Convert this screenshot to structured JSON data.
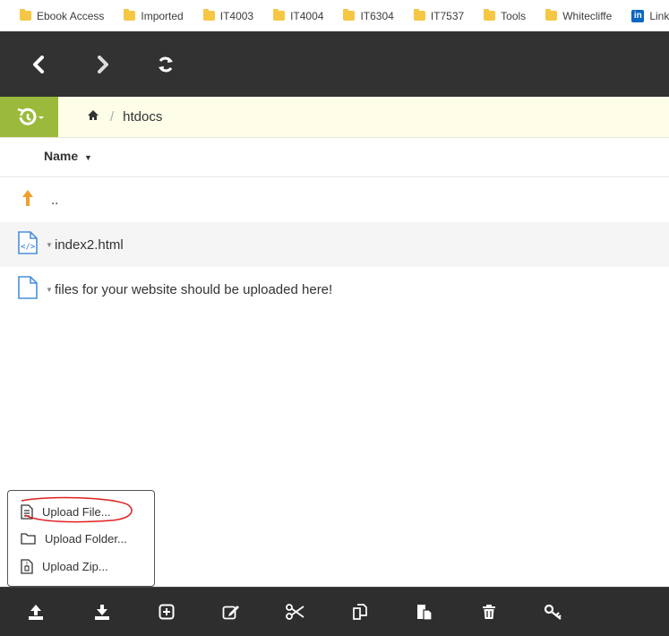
{
  "bookmarks": [
    {
      "label": "Ebook Access",
      "icon": "folder-icon"
    },
    {
      "label": "Imported",
      "icon": "folder-icon"
    },
    {
      "label": "IT4003",
      "icon": "folder-icon"
    },
    {
      "label": "IT4004",
      "icon": "folder-icon"
    },
    {
      "label": "IT6304",
      "icon": "folder-icon"
    },
    {
      "label": "IT7537",
      "icon": "folder-icon"
    },
    {
      "label": "Tools",
      "icon": "folder-icon"
    },
    {
      "label": "Whitecliffe",
      "icon": "folder-icon"
    },
    {
      "label": "LinkedIn Lea",
      "icon": "linkedin-icon"
    }
  ],
  "breadcrumb": {
    "home_icon": "home-icon",
    "separator": "/",
    "folder": "htdocs"
  },
  "columns": {
    "name": "Name"
  },
  "files": [
    {
      "name": "..",
      "icon": "parent-folder-icon"
    },
    {
      "name": "index2.html",
      "icon": "html-file-icon"
    },
    {
      "name": "files for your website should be uploaded here!",
      "icon": "file-icon"
    }
  ],
  "upload_menu": {
    "items": [
      {
        "label": "Upload File...",
        "icon": "file-text-icon"
      },
      {
        "label": "Upload Folder...",
        "icon": "folder-outline-icon"
      },
      {
        "label": "Upload Zip...",
        "icon": "zip-file-icon"
      }
    ]
  },
  "colors": {
    "nav_bg": "#323232",
    "history_green": "#9bba3c",
    "crumb_bg": "#fdfde8",
    "parent_arrow": "#f0a030",
    "file_icon_blue": "#4a90d9",
    "annotation_red": "#e02020"
  }
}
